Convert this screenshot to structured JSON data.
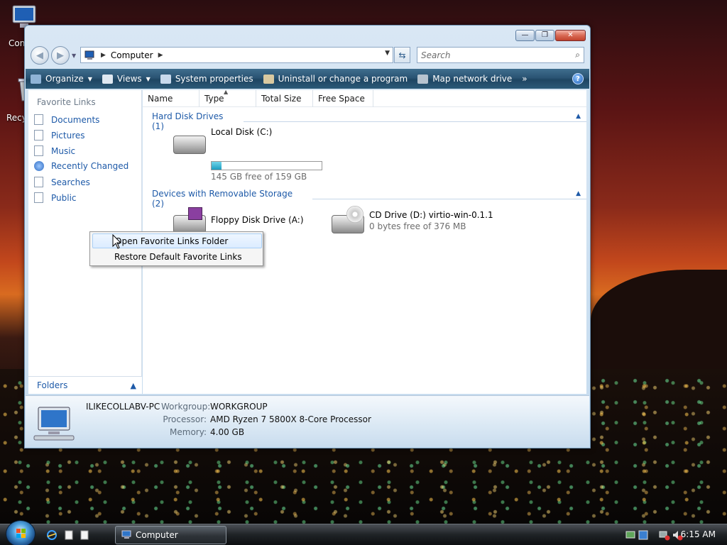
{
  "desktop": {
    "icons": [
      {
        "label": "Con"
      },
      {
        "label": "Recy"
      }
    ]
  },
  "window": {
    "title_buttons": {
      "minimize": "—",
      "maximize": "❐",
      "close": "✕"
    },
    "address": {
      "root_icon": "computer-icon",
      "path": "Computer"
    },
    "search": {
      "placeholder": "Search"
    },
    "toolbar": {
      "organize": "Organize",
      "views": "Views",
      "system_properties": "System properties",
      "uninstall": "Uninstall or change a program",
      "map_drive": "Map network drive",
      "more": "»",
      "help": "?"
    }
  },
  "nav": {
    "title": "Favorite Links",
    "items": [
      {
        "label": "Documents"
      },
      {
        "label": "Pictures"
      },
      {
        "label": "Music"
      },
      {
        "label": "Recently Changed"
      },
      {
        "label": "Searches"
      },
      {
        "label": "Public"
      }
    ],
    "folders": "Folders"
  },
  "columns": [
    "Name",
    "Type",
    "Total Size",
    "Free Space"
  ],
  "groups": {
    "hdd": {
      "title": "Hard Disk Drives (1)",
      "drive": {
        "name": "Local Disk (C:)",
        "sub": "145 GB free of 159 GB",
        "used_fraction": 0.09
      }
    },
    "removable": {
      "title": "Devices with Removable Storage (2)",
      "drives": [
        {
          "name": "Floppy Disk Drive (A:)",
          "sub": ""
        },
        {
          "name": "CD Drive (D:) virtio-win-0.1.1",
          "sub": "0 bytes free of 376 MB"
        }
      ]
    }
  },
  "details": {
    "pc_name": "ILIKECOLLABV-PC",
    "workgroup_label": "Workgroup:",
    "workgroup": "WORKGROUP",
    "processor_label": "Processor:",
    "processor": "AMD Ryzen 7 5800X 8-Core Processor",
    "memory_label": "Memory:",
    "memory": "4.00 GB"
  },
  "context_menu": {
    "items": [
      "Open Favorite Links Folder",
      "Restore Default Favorite Links"
    ]
  },
  "taskbar": {
    "task": "Computer",
    "clock": "6:15 AM"
  },
  "colors": {
    "accent": "#1e5aa8",
    "toolbar": "#2a5473"
  }
}
